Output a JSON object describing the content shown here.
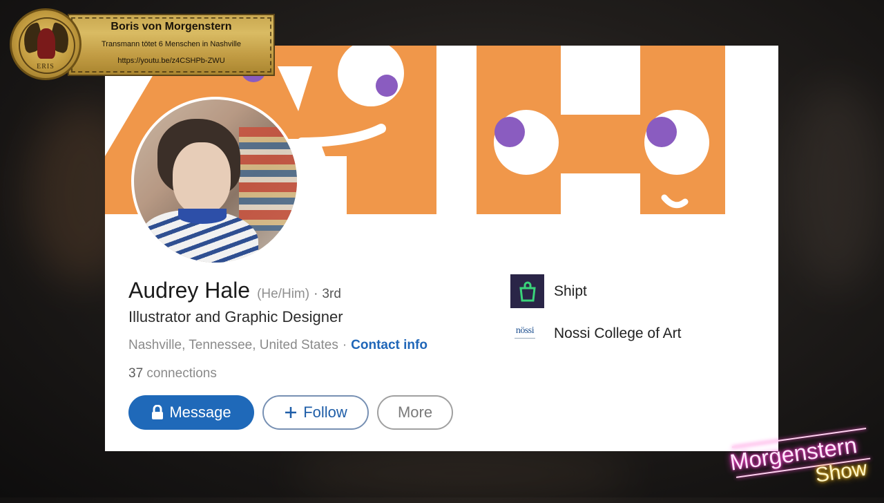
{
  "overlay_banner": {
    "presenter": "Boris von Morgenstern",
    "subtitle": "Transmann tötet 6 Menschen in Nashville",
    "url": "https://youtu.be/z4CSHPb-ZWU",
    "seal_text": "ERIS"
  },
  "profile": {
    "name": "Audrey Hale",
    "pronouns": "(He/Him)",
    "degree_separator": "·",
    "degree": "3rd",
    "headline": "Illustrator and Graphic Designer",
    "location": "Nashville, Tennessee, United States",
    "location_separator": "·",
    "contact_info_label": "Contact info",
    "connections_count": "37",
    "connections_label": "connections"
  },
  "actions": {
    "message_label": "Message",
    "message_icon": "lock-icon",
    "follow_label": "Follow",
    "follow_icon": "plus-icon",
    "more_label": "More"
  },
  "experience": [
    {
      "name": "Shipt",
      "logo": "shipt-logo"
    },
    {
      "name": "Nossi College of Art",
      "logo": "nossi-logo",
      "logo_text": "nössi"
    }
  ],
  "show_logo": {
    "line1": "Morgenstern",
    "line2": "Show"
  },
  "colors": {
    "cover_orange": "#f0974a",
    "cover_purple": "#8a5cc0",
    "linkedin_blue": "#1f69b9",
    "banner_gold": "#c9a850",
    "neon_pink": "#ff3fd1",
    "neon_yellow": "#ffcc33"
  }
}
